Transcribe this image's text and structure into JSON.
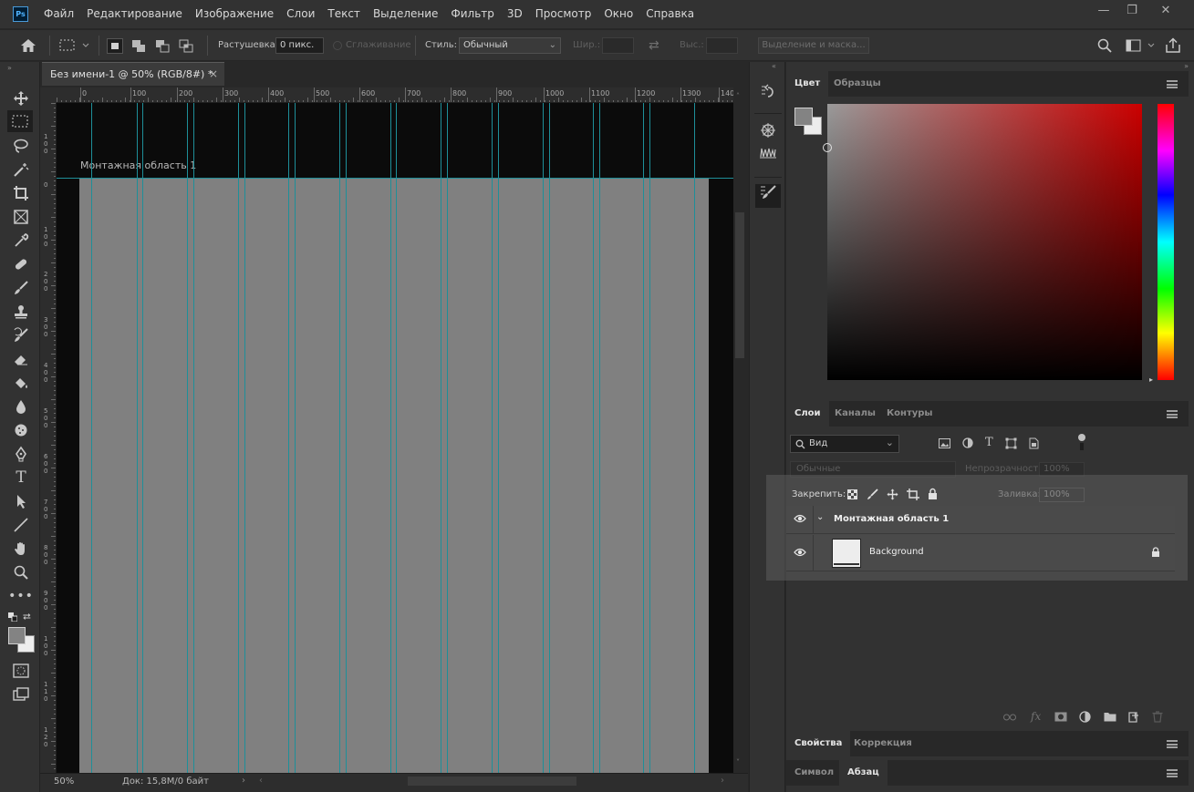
{
  "app": {
    "logo": "Ps"
  },
  "menu": [
    "Файл",
    "Редактирование",
    "Изображение",
    "Слои",
    "Текст",
    "Выделение",
    "Фильтр",
    "3D",
    "Просмотр",
    "Окно",
    "Справка"
  ],
  "window_buttons": [
    "—",
    "❐",
    "✕"
  ],
  "options_bar": {
    "feather_label": "Растушевка:",
    "feather_value": "0 пикс.",
    "antialias_label": "Сглаживание",
    "style_label": "Стиль:",
    "style_value": "Обычный",
    "width_label": "Шир.:",
    "height_label": "Выс.:",
    "select_mask_label": "Выделение и маска..."
  },
  "document": {
    "tab_title": "Без имени-1 @ 50% (RGB/8#) *",
    "artboard_label": "Монтажная область 1",
    "ruler_h": [
      "0",
      "100",
      "200",
      "300",
      "400",
      "500",
      "600",
      "700",
      "800",
      "900",
      "1000",
      "1100",
      "1200",
      "1300",
      "140"
    ],
    "ruler_v": [
      "1\n0\n0",
      "0",
      "1\n0\n0",
      "2\n0\n0",
      "3\n0\n0",
      "4\n0\n0",
      "5\n0\n0",
      "6\n0\n0",
      "7\n0\n0",
      "8\n0\n0",
      "9\n0\n0",
      "1\n0\n0",
      "1\n1\n0",
      "1\n2\n0"
    ]
  },
  "status": {
    "zoom": "50%",
    "doc_info": "Док: 15,8M/0 байт"
  },
  "color_panel": {
    "tabs": [
      "Цвет",
      "Образцы"
    ],
    "foreground": "#838383",
    "background": "#ededed"
  },
  "layers_panel": {
    "tabs": [
      "Слои",
      "Каналы",
      "Контуры"
    ],
    "filter_label": "Вид",
    "blend_mode": "Обычные",
    "opacity_label": "Непрозрачность:",
    "opacity_value": "100%",
    "lock_label": "Закрепить:",
    "fill_label": "Заливка:",
    "fill_value": "100%",
    "layers": [
      {
        "name": "Монтажная область 1",
        "type": "artboard"
      },
      {
        "name": "Background",
        "type": "layer",
        "locked": true
      }
    ]
  },
  "properties_panel": {
    "tabs": [
      "Свойства",
      "Коррекция"
    ]
  },
  "paragraph_panel": {
    "tabs": [
      "Символ",
      "Абзац"
    ]
  },
  "colors": {
    "guide": "#1e8f99",
    "artboard": "#808080",
    "canvas_bg": "#0b0b0b",
    "ui_bg": "#323232"
  }
}
